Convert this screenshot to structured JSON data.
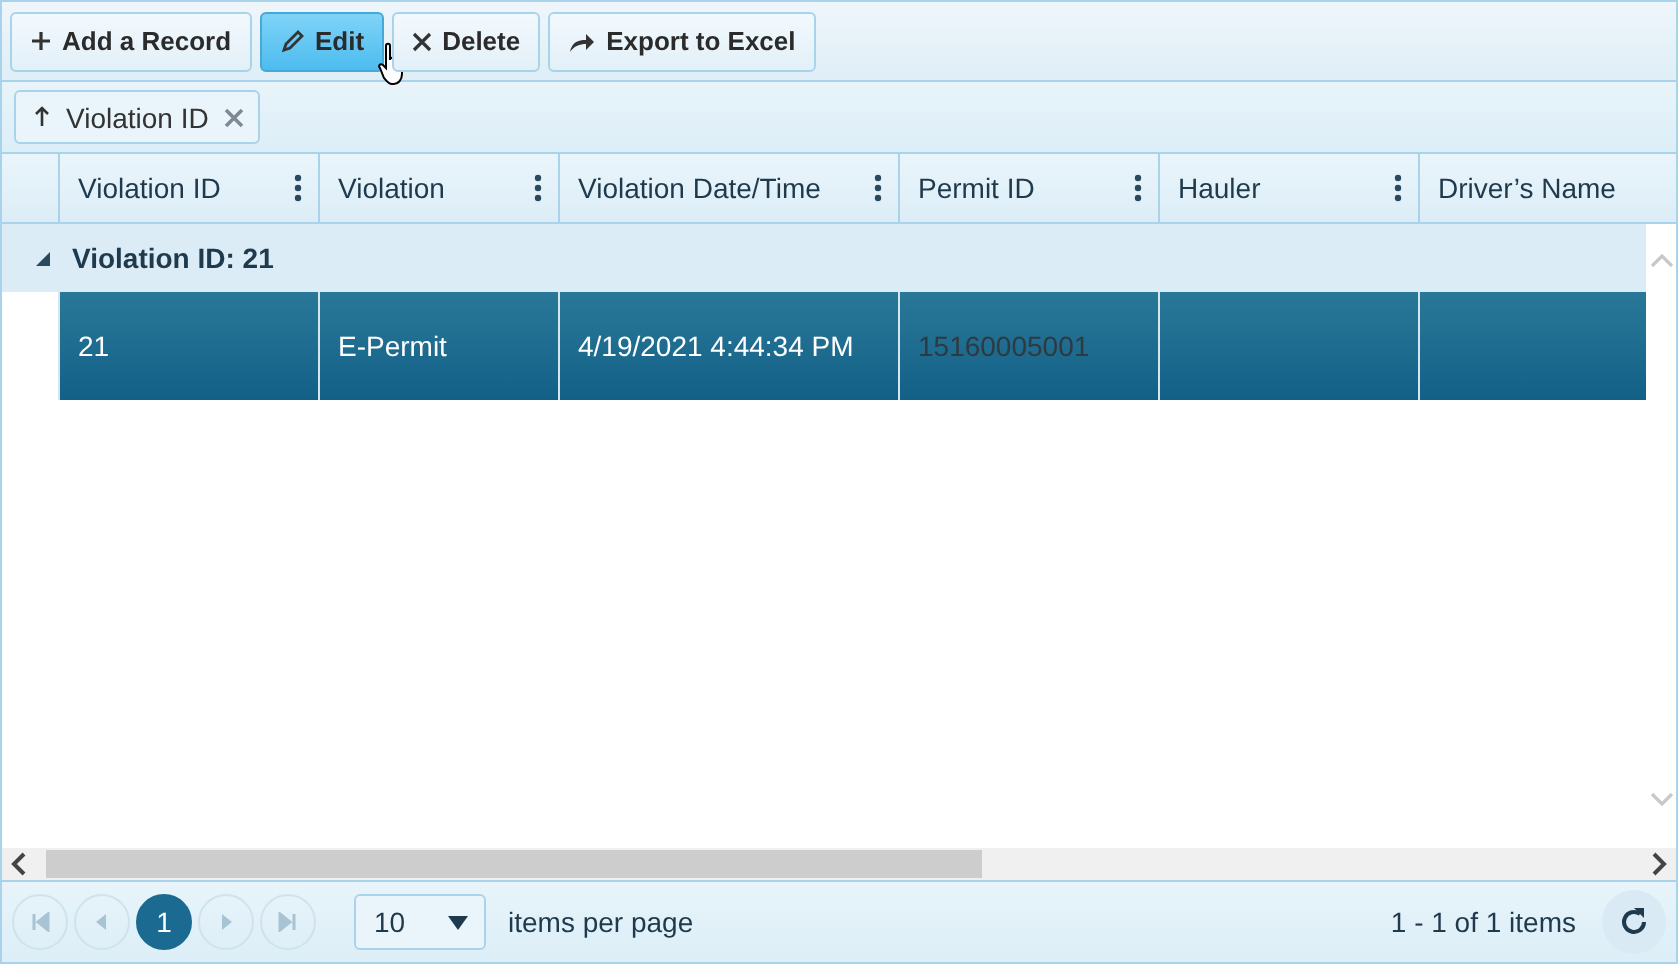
{
  "toolbar": [
    {
      "kind": "add",
      "label": "Add a Record",
      "hovered": false
    },
    {
      "kind": "edit",
      "label": "Edit",
      "hovered": true
    },
    {
      "kind": "delete",
      "label": "Delete",
      "hovered": false
    },
    {
      "kind": "export",
      "label": "Export to Excel",
      "hovered": false
    }
  ],
  "group_chips": [
    {
      "label": "Violation ID"
    }
  ],
  "table": {
    "columns": [
      {
        "label": "Violation ID",
        "menu": true
      },
      {
        "label": "Violation",
        "menu": true
      },
      {
        "label": "Violation Date/Time",
        "menu": true
      },
      {
        "label": "Permit ID",
        "menu": true
      },
      {
        "label": "Hauler",
        "menu": true
      },
      {
        "label": "Driver’s Name",
        "menu": false
      }
    ],
    "groups": [
      {
        "label": "Violation ID: 21",
        "expanded": true,
        "rows": [
          {
            "selected": true,
            "cells": [
              {
                "text": "21",
                "dim": false
              },
              {
                "text": "E-Permit",
                "dim": false
              },
              {
                "text": "4/19/2021 4:44:34 PM",
                "dim": false
              },
              {
                "text": "15160005001",
                "dim": true
              },
              {},
              {}
            ]
          }
        ]
      }
    ]
  },
  "pager": {
    "nav": [
      {
        "kind": "first",
        "disabled": true
      },
      {
        "kind": "prev",
        "disabled": true
      },
      {
        "kind": "page",
        "label": "1",
        "selected": true
      },
      {
        "kind": "next",
        "disabled": true
      },
      {
        "kind": "last",
        "disabled": true
      }
    ],
    "page_size": "10",
    "page_size_label": "items per page",
    "summary": "1 - 1 of 1 items"
  }
}
